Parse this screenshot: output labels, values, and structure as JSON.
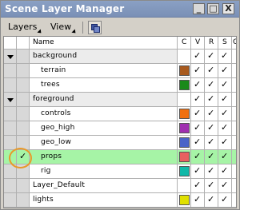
{
  "window": {
    "title": "Scene Layer Manager",
    "buttons": {
      "minimize": "_",
      "maximize": "□",
      "close": "X"
    }
  },
  "menubar": {
    "layers": "Layers",
    "view": "View"
  },
  "columns": {
    "name": "Name",
    "c": "C",
    "v": "V",
    "r": "R",
    "s": "S",
    "g": "G"
  },
  "colors": {
    "selected_row": "#a6f4a6",
    "terrain": "#a85a1e",
    "trees": "#1a8a1a",
    "controls": "#f07010",
    "geo_high": "#a030b0",
    "geo_low": "#4a64c8",
    "props": "#e86060",
    "rig": "#10b8a8",
    "lights": "#e0e000"
  },
  "rows": [
    {
      "name": "background",
      "level": 0,
      "expanded": true,
      "checked": false,
      "v": "✓",
      "r": "✓",
      "s": "✓"
    },
    {
      "name": "terrain",
      "level": 1,
      "swatch": "terrain",
      "checked": false,
      "v": "✓",
      "r": "✓",
      "s": "✓"
    },
    {
      "name": "trees",
      "level": 1,
      "swatch": "trees",
      "checked": false,
      "v": "✓",
      "r": "✓",
      "s": "✓"
    },
    {
      "name": "foreground",
      "level": 0,
      "expanded": true,
      "checked": false,
      "v": "✓",
      "r": "✓",
      "s": "✓"
    },
    {
      "name": "controls",
      "level": 1,
      "swatch": "controls",
      "checked": false,
      "v": "✓",
      "r": "✓",
      "s": "✓"
    },
    {
      "name": "geo_high",
      "level": 1,
      "swatch": "geo_high",
      "checked": false,
      "v": "✓",
      "r": "✓",
      "s": "✓"
    },
    {
      "name": "geo_low",
      "level": 1,
      "swatch": "geo_low",
      "checked": false,
      "v": "✓",
      "r": "✓",
      "s": "✓"
    },
    {
      "name": "props",
      "level": 1,
      "swatch": "props",
      "checked": true,
      "check_mark": "✓",
      "selected": true,
      "v": "✓",
      "r": "✓",
      "s": "✓"
    },
    {
      "name": "rig",
      "level": 1,
      "swatch": "rig",
      "checked": false,
      "v": "✓",
      "r": "✓",
      "s": "✓"
    },
    {
      "name": "Layer_Default",
      "level": 0,
      "checked": false,
      "v": "✓",
      "r": "✓",
      "s": "✓"
    },
    {
      "name": "lights",
      "level": 0,
      "swatch": "lights",
      "checked": false,
      "v": "✓",
      "r": "✓",
      "s": "✓"
    }
  ]
}
